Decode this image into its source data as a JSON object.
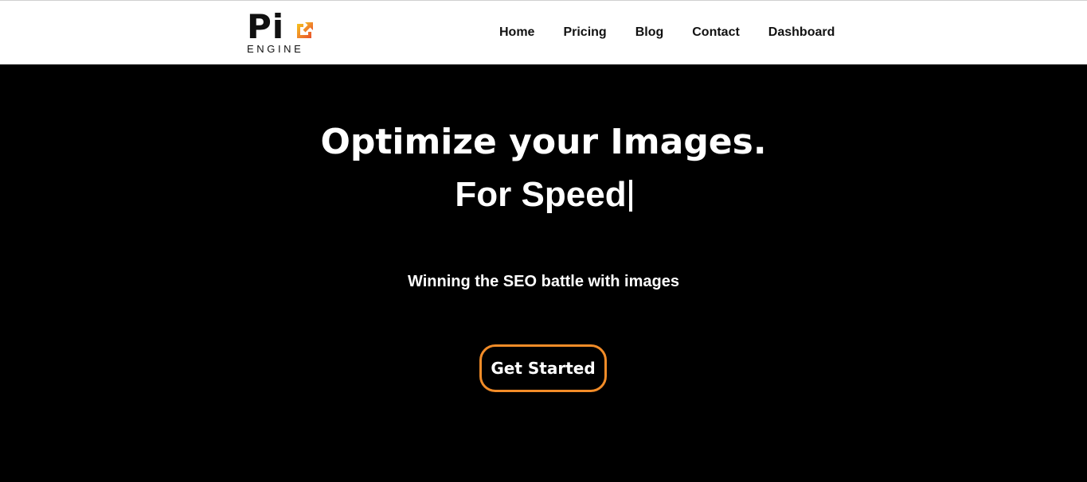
{
  "header": {
    "logo": {
      "wordmark": "Pi",
      "subtitle": "ENGINE",
      "mark_icon": "image-arrow-icon",
      "mark_colors": [
        "#f6c31c",
        "#f08a2a",
        "#e8502a"
      ]
    },
    "nav": [
      {
        "label": "Home"
      },
      {
        "label": "Pricing"
      },
      {
        "label": "Blog"
      },
      {
        "label": "Contact"
      },
      {
        "label": "Dashboard"
      }
    ]
  },
  "hero": {
    "headline": "Optimize your Images.",
    "typed_text": "For Speed",
    "subtitle": "Winning the SEO battle with images",
    "cta_label": "Get Started"
  },
  "colors": {
    "header_bg": "#ffffff",
    "hero_bg": "#000000",
    "accent": "#f28c28",
    "text_light": "#ffffff",
    "text_dark": "#111111"
  }
}
